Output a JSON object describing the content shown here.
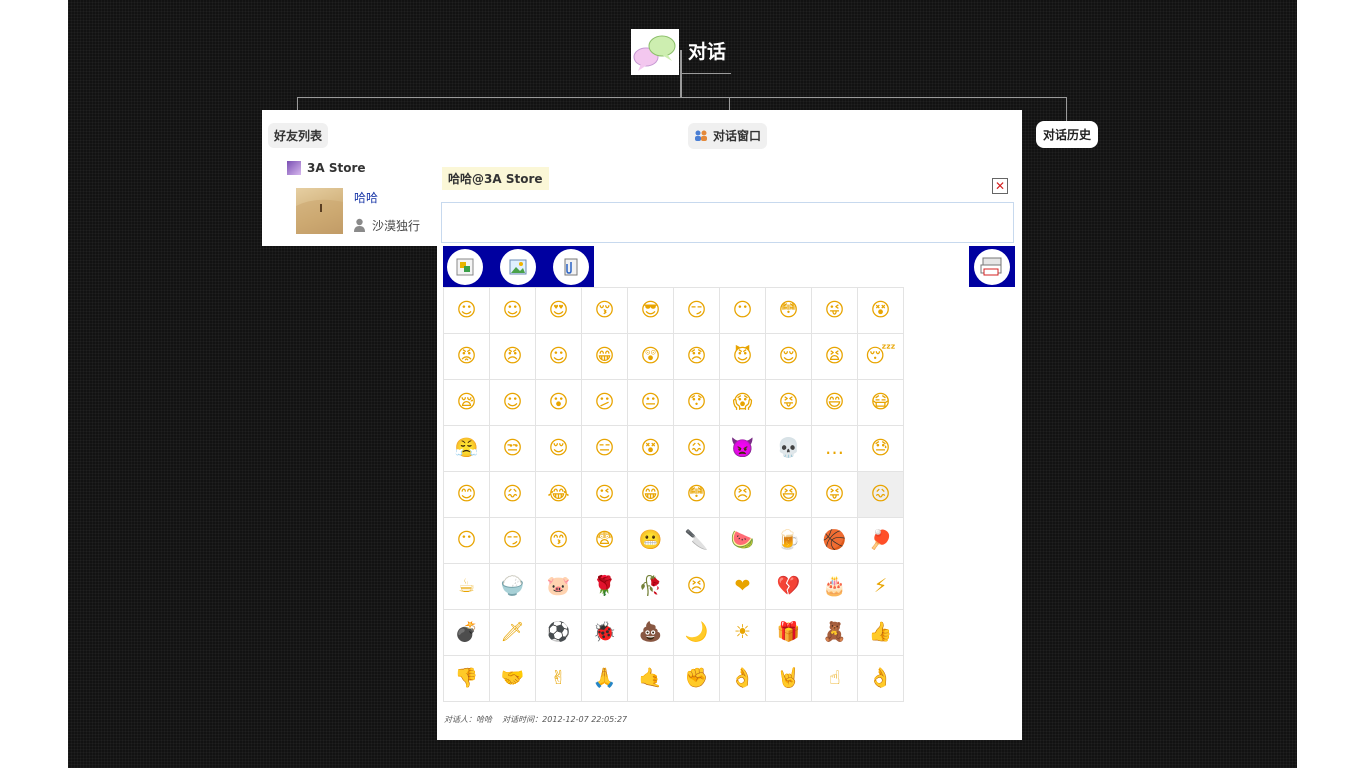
{
  "root": {
    "title": "对话"
  },
  "tabs": {
    "friends": "好友列表",
    "chat_window": "对话窗口",
    "history": "对话历史"
  },
  "friend_list": {
    "store_name": "3A Store",
    "friend": {
      "name": "哈哈",
      "signature": "沙漠独行"
    }
  },
  "chat": {
    "title": "哈哈@3A Store",
    "close_label": "✕",
    "input_value": "",
    "meta_label_user": "对话人：哈哈",
    "meta_label_time": "对话时间：2012-12-07 22:05:27"
  },
  "toolbar": {
    "left_icons": [
      "text-format-icon",
      "image-icon",
      "attachment-icon"
    ],
    "right_icons": [
      "window-resize-icon"
    ]
  },
  "emoticons": [
    "☺",
    "☺",
    "😍",
    "😚",
    "😎",
    "😏",
    "😶",
    "😳",
    "😜",
    "😵",
    "😡",
    "😠",
    "☺",
    "😁",
    "😲",
    "😞",
    "😈",
    "😌",
    "😫",
    "😴",
    "😪",
    "☺",
    "😮",
    "😕",
    "😐",
    "😯",
    "😱",
    "😝",
    "😄",
    "😷",
    "😤",
    "😒",
    "😌",
    "😑",
    "😵",
    "😖",
    "👿",
    "💀",
    "…",
    "😓",
    "😊",
    "😖",
    "😂",
    "😉",
    "😁",
    "😳",
    "😣",
    "😆",
    "😝",
    "😖",
    "😶",
    "😏",
    "😙",
    "😨",
    "😬",
    "🔪",
    "🍉",
    "🍺",
    "🏀",
    "🏓",
    "☕",
    "🍚",
    "🐷",
    "🌹",
    "🥀",
    "😣",
    "❤",
    "💔",
    "🎂",
    "⚡",
    "💣",
    "🗡",
    "⚽",
    "🐞",
    "💩",
    "🌙",
    "☀",
    "🎁",
    "🧸",
    "👍",
    "👎",
    "🤝",
    "✌",
    "🙏",
    "🤙",
    "✊",
    "👌",
    "🤘",
    "☝",
    "👌"
  ],
  "emoticon_names": [
    "smile",
    "shy",
    "love-eyes",
    "kiss",
    "cool",
    "smirk",
    "speechless",
    "stunned",
    "wink",
    "dizzy",
    "angry",
    "furious",
    "happy",
    "grin",
    "shocked",
    "sad",
    "evil",
    "relieved",
    "tired",
    "sleepy",
    "thinking",
    "blush",
    "surprised",
    "confused",
    "neutral",
    "puzzled",
    "scared",
    "tongue",
    "laugh",
    "sick",
    "ninja",
    "annoyed",
    "scheming",
    "bored",
    "dizzy2",
    "crying",
    "devil",
    "skull",
    "sweat",
    "worried",
    "giggle",
    "frustrated",
    "tears-of-joy",
    "wink2",
    "grin2",
    "embarrassed",
    "pained",
    "laughing",
    "playful",
    "awkward",
    "silent",
    "smug",
    "whistle",
    "fearful",
    "grimace",
    "knife",
    "watermelon",
    "beer",
    "basketball",
    "ping-pong",
    "coffee",
    "rice",
    "pig",
    "rose",
    "withered-rose",
    "sulk",
    "heart",
    "broken-heart",
    "cake",
    "lightning",
    "bomb",
    "dagger",
    "soccer",
    "ladybug",
    "poop",
    "moon",
    "sun",
    "gift",
    "hug",
    "thumbs-up",
    "thumbs-down",
    "handshake",
    "victory",
    "pray",
    "call-me",
    "fist",
    "ok",
    "rock",
    "point-up",
    "ok-hand"
  ],
  "emoticon_highlight_index": 49,
  "colors": {
    "background": "#121212",
    "panel": "#ffffff",
    "toolbar": "#0000a0",
    "link": "#1a37a8",
    "title_tag": "#fbf7d7"
  }
}
